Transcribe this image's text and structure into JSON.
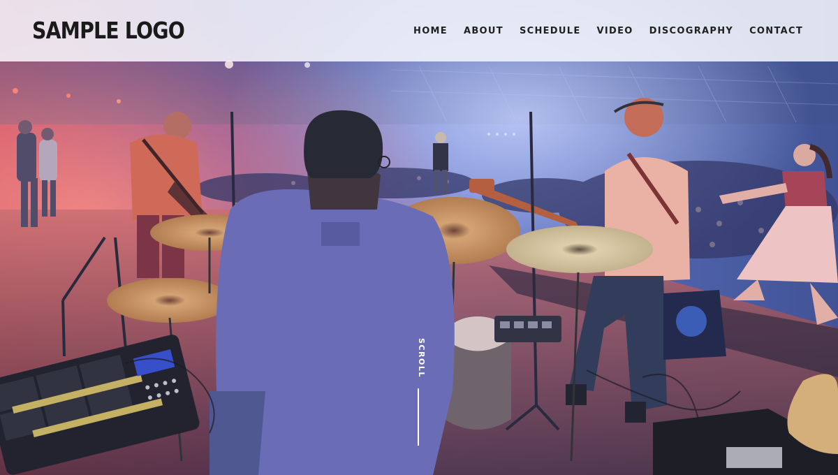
{
  "header": {
    "logo_text": "SAMPLE LOGO",
    "nav": [
      {
        "label": "HOME"
      },
      {
        "label": "ABOUT"
      },
      {
        "label": "SCHEDULE"
      },
      {
        "label": "VIDEO"
      },
      {
        "label": "DISCOGRAPHY"
      },
      {
        "label": "CONTACT"
      }
    ]
  },
  "hero": {
    "scroll_label": "SCROLL",
    "image_description_colors": {
      "stage_light": "#e8646b",
      "crowd_blue": "#4a5fb0",
      "jacket_blue": "#5d62a8"
    }
  }
}
